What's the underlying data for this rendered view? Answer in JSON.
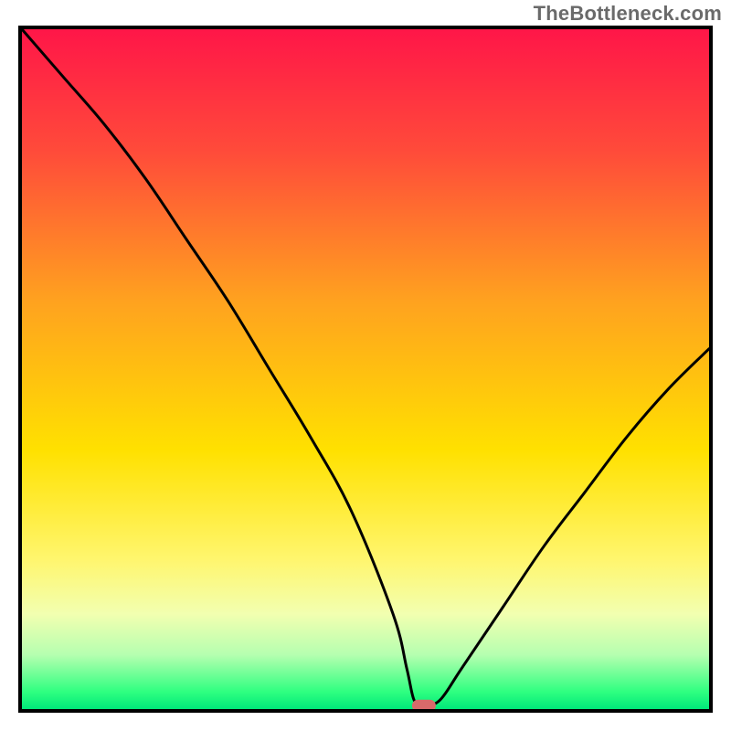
{
  "watermark": "TheBottleneck.com",
  "chart_data": {
    "type": "line",
    "title": "",
    "xlabel": "",
    "ylabel": "",
    "xlim": [
      0,
      100
    ],
    "ylim": [
      0,
      100
    ],
    "grid": false,
    "series": [
      {
        "name": "bottleneck-curve",
        "x": [
          0,
          6,
          12,
          18,
          24,
          30,
          36,
          42,
          48,
          54,
          56,
          57,
          58,
          59,
          61,
          64,
          70,
          76,
          82,
          88,
          94,
          100
        ],
        "y": [
          100,
          93,
          86,
          78,
          69,
          60,
          50,
          40,
          29,
          14,
          6,
          1.5,
          0.5,
          0.5,
          1.5,
          6,
          15,
          24,
          32,
          40,
          47,
          53
        ]
      }
    ],
    "marker": {
      "name": "target-marker",
      "x": 58.5,
      "y": 0.5,
      "color": "#d86a6a",
      "shape": "pill"
    },
    "background": {
      "type": "vertical-gradient",
      "stops": [
        {
          "offset": 0.0,
          "color": "#ff1648"
        },
        {
          "offset": 0.18,
          "color": "#ff4b3a"
        },
        {
          "offset": 0.4,
          "color": "#ffa21f"
        },
        {
          "offset": 0.62,
          "color": "#ffe100"
        },
        {
          "offset": 0.78,
          "color": "#fff66e"
        },
        {
          "offset": 0.86,
          "color": "#f2ffb0"
        },
        {
          "offset": 0.92,
          "color": "#b6ffb0"
        },
        {
          "offset": 0.975,
          "color": "#2eff80"
        },
        {
          "offset": 1.0,
          "color": "#00e87a"
        }
      ]
    },
    "border_color": "#000000",
    "border_width": 4
  }
}
